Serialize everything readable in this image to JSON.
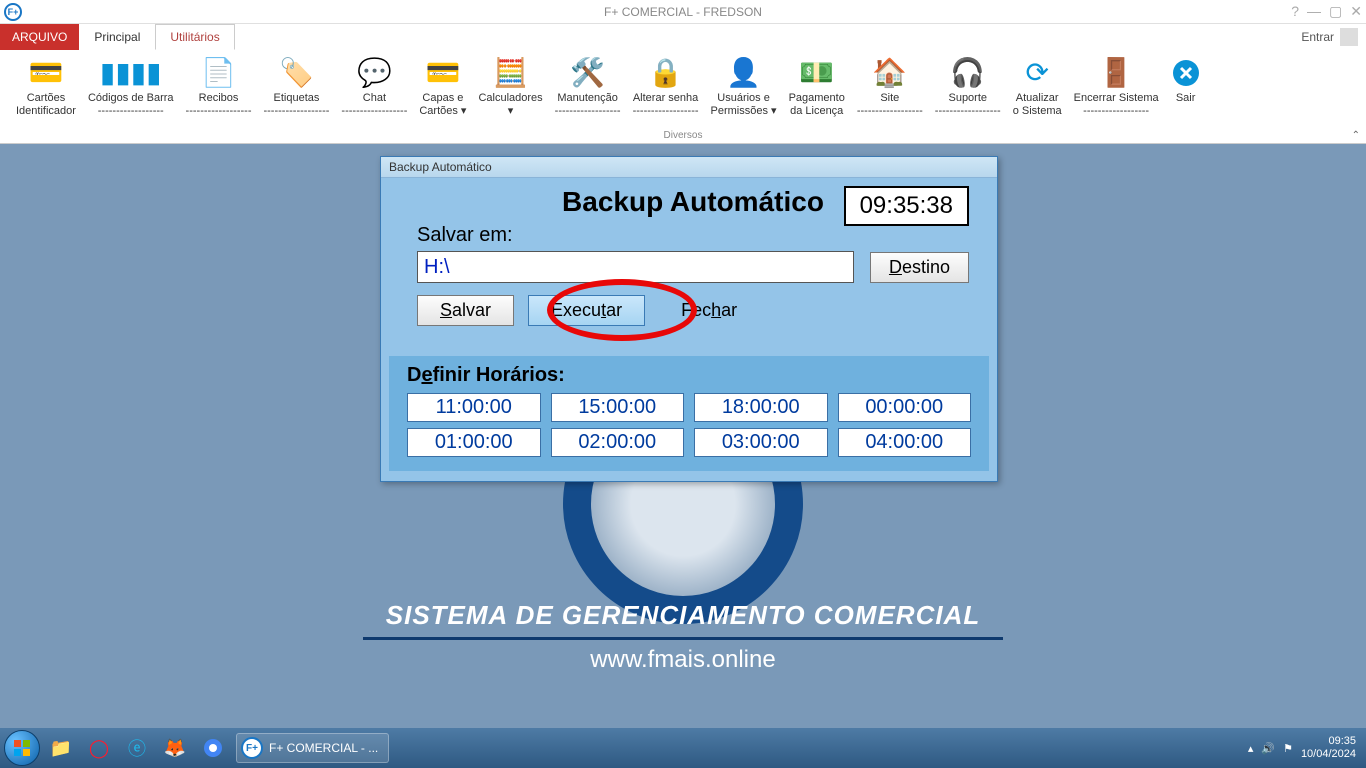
{
  "titlebar": {
    "title": "F+ COMERCIAL - FREDSON"
  },
  "tabs": {
    "file": "ARQUIVO",
    "principal": "Principal",
    "utilitarios": "Utilitários",
    "login": "Entrar"
  },
  "ribbon": {
    "group_label": "Diversos",
    "items": [
      {
        "label": "Cartões\nIdentificador"
      },
      {
        "label": "Códigos de Barra\n------------------"
      },
      {
        "label": "Recibos\n------------------"
      },
      {
        "label": "Etiquetas\n------------------"
      },
      {
        "label": "Chat\n------------------"
      },
      {
        "label": "Capas e\nCartões ▾"
      },
      {
        "label": "Calculadores\n▾"
      },
      {
        "label": "Manutenção\n------------------"
      },
      {
        "label": "Alterar senha\n------------------"
      },
      {
        "label": "Usuários e\nPermissões ▾"
      },
      {
        "label": "Pagamento\nda Licença"
      },
      {
        "label": "Site\n------------------"
      },
      {
        "label": "Suporte\n------------------"
      },
      {
        "label": "Atualizar\no Sistema"
      },
      {
        "label": "Encerrar Sistema\n------------------"
      },
      {
        "label": "Sair"
      }
    ]
  },
  "background": {
    "headline": "SISTEMA DE GERENCIAMENTO COMERCIAL",
    "url": "www.fmais.online"
  },
  "dialog": {
    "window_title": "Backup Automático",
    "heading": "Backup Automático",
    "clock": "09:35:38",
    "save_in_label": "Salvar em:",
    "path_value": "H:\\",
    "btn_destino": "Destino",
    "btn_salvar": "Salvar",
    "btn_executar": "Executar",
    "btn_fechar": "Fechar",
    "schedule_label": "Definir Horários:",
    "times": [
      "11:00:00",
      "15:00:00",
      "18:00:00",
      "00:00:00",
      "01:00:00",
      "02:00:00",
      "03:00:00",
      "04:00:00"
    ]
  },
  "taskbar": {
    "task_label": "F+ COMERCIAL - ...",
    "time": "09:35",
    "date": "10/04/2024"
  }
}
